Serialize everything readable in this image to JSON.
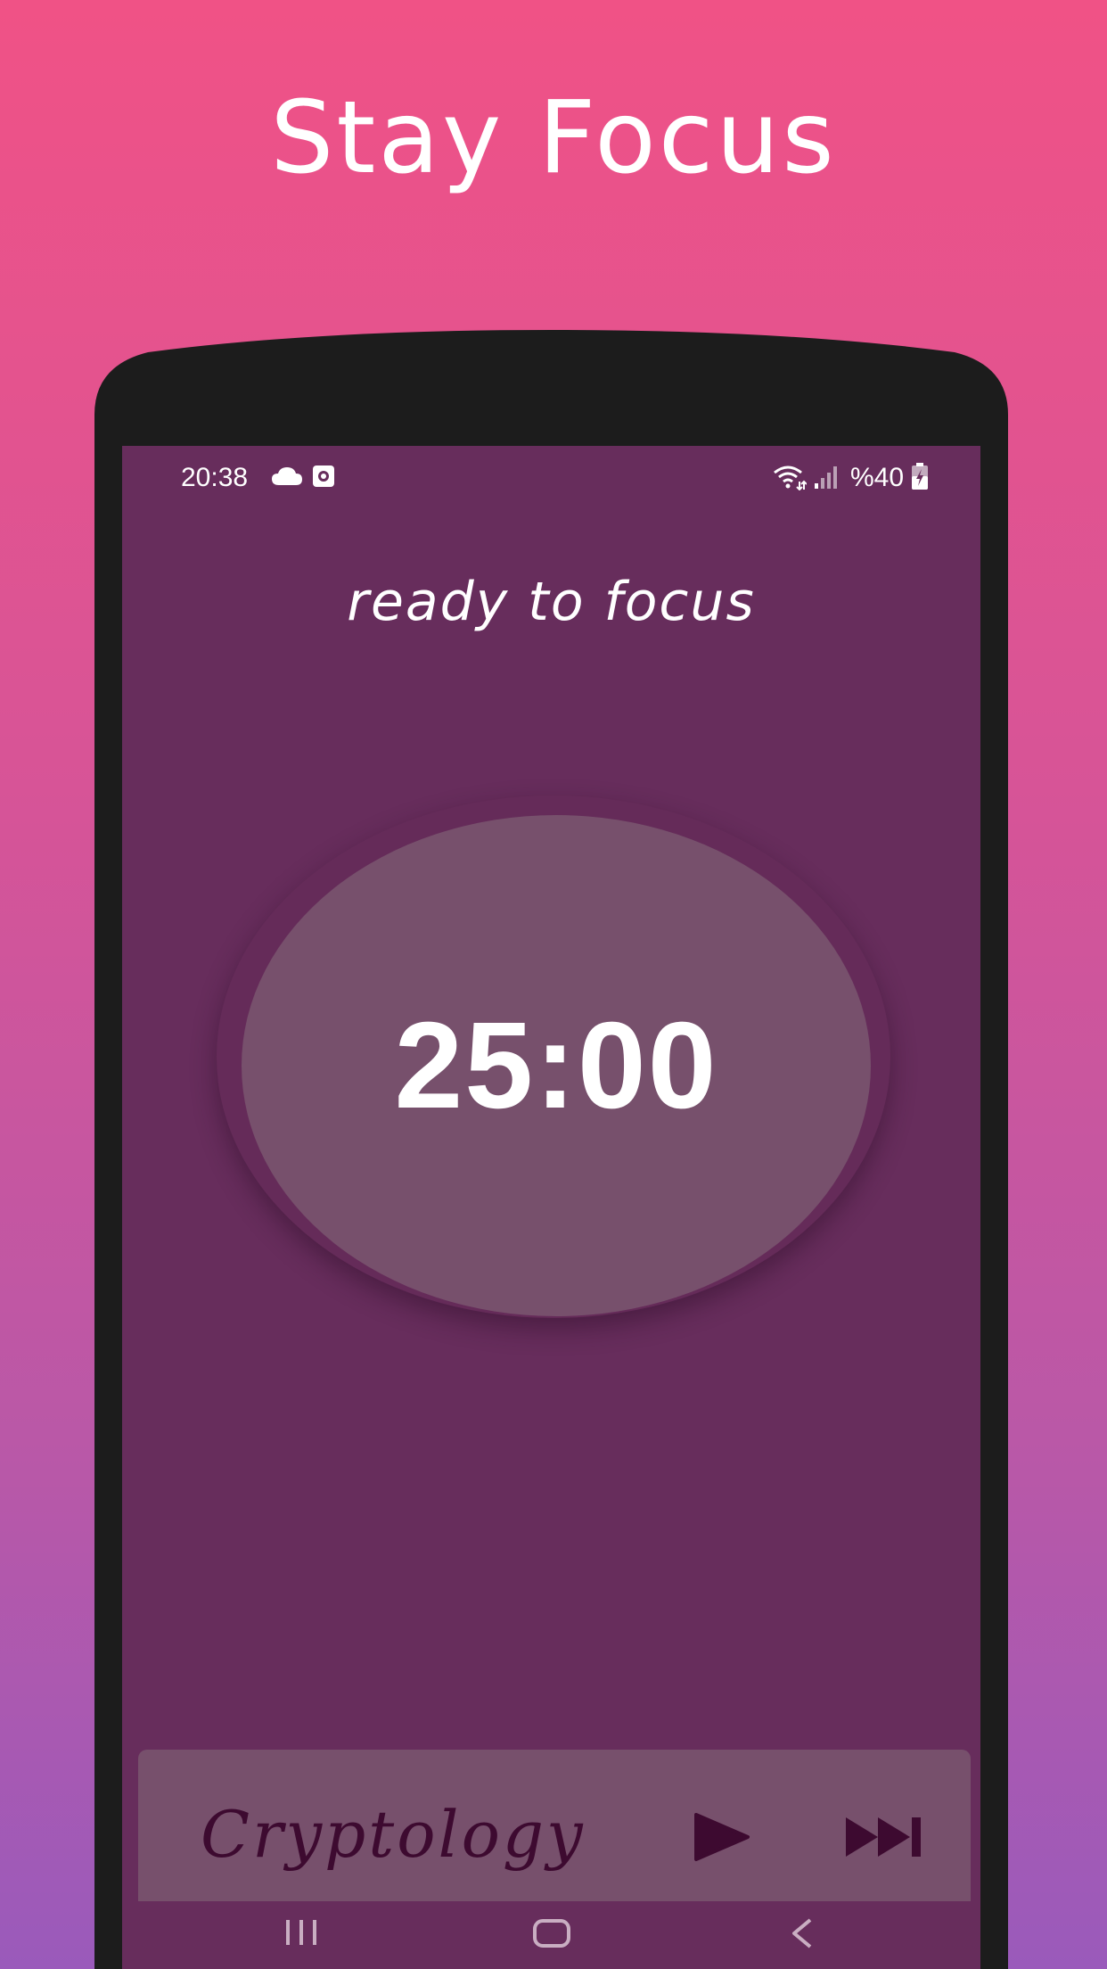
{
  "headline": "Stay Focus",
  "status_bar": {
    "time": "20:38",
    "battery": "%40",
    "icons": [
      "cloud-icon",
      "screen-record-icon",
      "wifi-icon",
      "signal-icon",
      "battery-charging-icon"
    ]
  },
  "subtitle": "ready to focus",
  "timer": {
    "display": "25:00"
  },
  "player": {
    "track": "Cryptology",
    "play_icon": "play-icon",
    "next_icon": "skip-next-icon"
  },
  "nav_bar": {
    "icons": [
      "recent-apps-icon",
      "home-icon",
      "back-icon"
    ]
  },
  "colors": {
    "gradient_top": "#f05286",
    "gradient_bottom": "#9a5abb",
    "screen_bg": "#672d5c",
    "card_bg": "#77506c",
    "frame": "#1c1c1c",
    "track_text": "#3d0a30"
  }
}
